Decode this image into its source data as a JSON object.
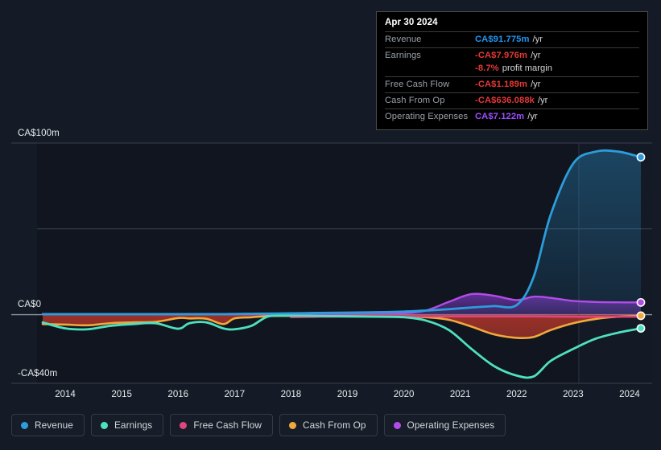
{
  "tooltip": {
    "date": "Apr 30 2024",
    "rows": [
      {
        "label": "Revenue",
        "value": "CA$91.775m",
        "color": "#2196f3",
        "suffix": "/yr"
      },
      {
        "label": "Earnings",
        "value": "-CA$7.976m",
        "color": "#e53935",
        "suffix": "/yr"
      },
      {
        "label": "",
        "value": "-8.7%",
        "color": "#e53935",
        "suffix": "profit margin"
      },
      {
        "label": "Free Cash Flow",
        "value": "-CA$1.189m",
        "color": "#e53935",
        "suffix": "/yr"
      },
      {
        "label": "Cash From Op",
        "value": "-CA$636.088k",
        "color": "#e53935",
        "suffix": "/yr"
      },
      {
        "label": "Operating Expenses",
        "value": "CA$7.122m",
        "color": "#9c4dff",
        "suffix": "/yr"
      }
    ]
  },
  "legend": {
    "items": [
      {
        "label": "Revenue",
        "color": "#2d9cdb"
      },
      {
        "label": "Earnings",
        "color": "#4fe0c0"
      },
      {
        "label": "Free Cash Flow",
        "color": "#e0457b"
      },
      {
        "label": "Cash From Op",
        "color": "#f0a93c"
      },
      {
        "label": "Operating Expenses",
        "color": "#b24ce8"
      }
    ]
  },
  "axis": {
    "y_top": "CA$100m",
    "y_zero": "CA$0",
    "y_bottom": "-CA$40m",
    "x_ticks": [
      "2014",
      "2015",
      "2016",
      "2017",
      "2018",
      "2019",
      "2020",
      "2021",
      "2022",
      "2023",
      "2024"
    ]
  },
  "chart_data": {
    "type": "area",
    "title": "",
    "xlabel": "",
    "ylabel": "CA$",
    "ylim": [
      -40,
      100
    ],
    "xlim": [
      2013.5,
      2024.4
    ],
    "gridlines": [
      0,
      50,
      100
    ],
    "currency": "CA$",
    "units": "millions",
    "forecast_divider_x": 2023.1,
    "categories": [
      2013.6,
      2014,
      2014.4,
      2014.8,
      2015.2,
      2015.6,
      2016,
      2016.2,
      2016.5,
      2016.8,
      2017,
      2017.3,
      2017.6,
      2018,
      2018.5,
      2019,
      2019.5,
      2020,
      2020.4,
      2020.8,
      2021.2,
      2021.6,
      2022,
      2022.3,
      2022.6,
      2023,
      2023.4,
      2023.8,
      2024.2
    ],
    "series": [
      {
        "name": "Revenue",
        "color": "#2d9cdb",
        "values": [
          0.3,
          0.3,
          0.3,
          0.3,
          0.3,
          0.3,
          0.3,
          0.3,
          0.3,
          0.3,
          0.4,
          0.5,
          0.6,
          0.8,
          1.0,
          1.2,
          1.4,
          1.8,
          2.4,
          3.2,
          4.2,
          5.0,
          5.6,
          22,
          58,
          88,
          95,
          95,
          91.775
        ]
      },
      {
        "name": "Earnings",
        "color": "#4fe0c0",
        "values": [
          -4.5,
          -8.0,
          -8.5,
          -6.5,
          -5.5,
          -5.0,
          -8.2,
          -5.0,
          -4.5,
          -8.0,
          -8.5,
          -6.5,
          -1.0,
          -0.6,
          -0.8,
          -1.0,
          -1.2,
          -1.5,
          -3.5,
          -9.0,
          -20,
          -30,
          -35.5,
          -36,
          -27,
          -20,
          -14,
          -10.5,
          -7.976
        ]
      },
      {
        "name": "Free Cash Flow",
        "color": "#e0457b",
        "values": [
          null,
          null,
          null,
          null,
          null,
          null,
          null,
          null,
          null,
          null,
          null,
          null,
          null,
          -1.4,
          -1.2,
          -1.1,
          -1.0,
          -1.0,
          -1.0,
          -1.0,
          -1.0,
          -1.0,
          -1.0,
          -1.0,
          -1.1,
          -1.2,
          -1.2,
          -1.2,
          -1.189
        ]
      },
      {
        "name": "Cash From Op",
        "color": "#f0a93c",
        "values": [
          -5.5,
          -5.8,
          -6.2,
          -5.0,
          -4.5,
          -4.2,
          -2.0,
          -2.2,
          -2.4,
          -5.5,
          -2.2,
          -1.5,
          -0.8,
          -0.7,
          -0.8,
          -0.9,
          -1.0,
          -1.1,
          -1.5,
          -3.0,
          -7.0,
          -11.5,
          -13.5,
          -13.0,
          -9.0,
          -5.0,
          -2.5,
          -1.2,
          -0.636
        ]
      },
      {
        "name": "Operating Expenses",
        "color": "#b24ce8",
        "values": [
          0.2,
          0.2,
          0.2,
          0.2,
          0.2,
          0.2,
          0.2,
          0.2,
          0.2,
          0.2,
          0.2,
          0.2,
          0.3,
          0.4,
          0.4,
          0.5,
          0.6,
          0.8,
          2.5,
          7.5,
          12.0,
          11.0,
          8.5,
          10.5,
          9.8,
          8.0,
          7.4,
          7.2,
          7.122
        ]
      }
    ]
  }
}
